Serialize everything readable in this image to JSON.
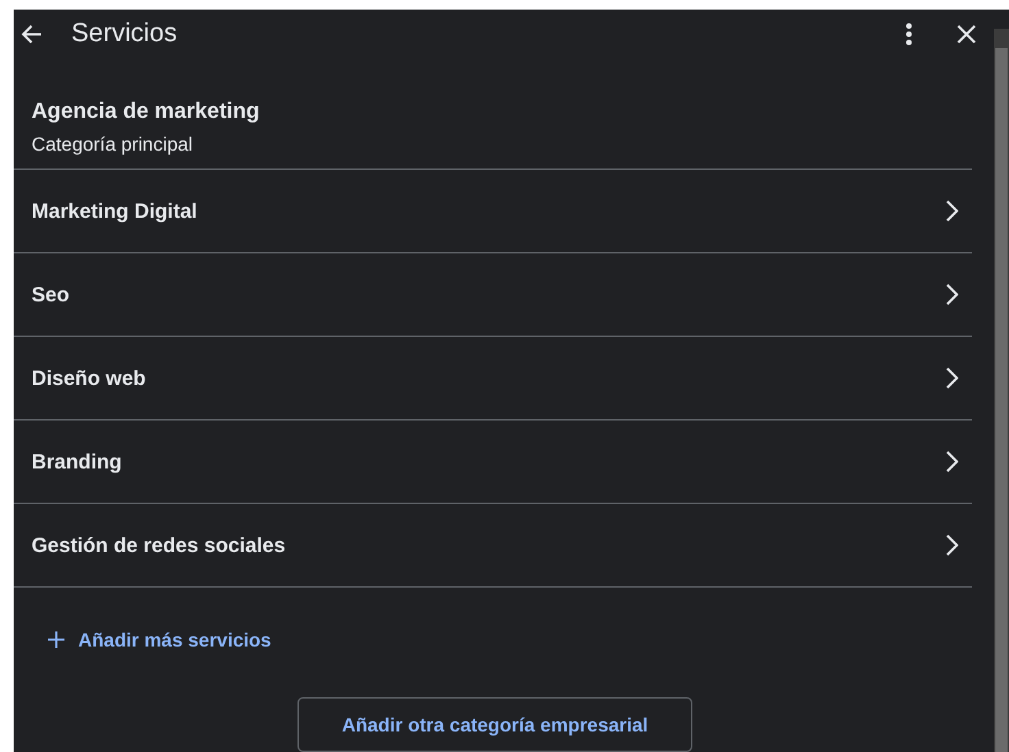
{
  "header": {
    "title": "Servicios"
  },
  "category": {
    "name": "Agencia de marketing",
    "label": "Categoría principal"
  },
  "services": [
    {
      "name": "Marketing Digital"
    },
    {
      "name": "Seo"
    },
    {
      "name": "Diseño web"
    },
    {
      "name": "Branding"
    },
    {
      "name": "Gestión de redes sociales"
    }
  ],
  "add_link": "Añadir más servicios",
  "add_category_button": "Añadir otra categoría empresarial"
}
